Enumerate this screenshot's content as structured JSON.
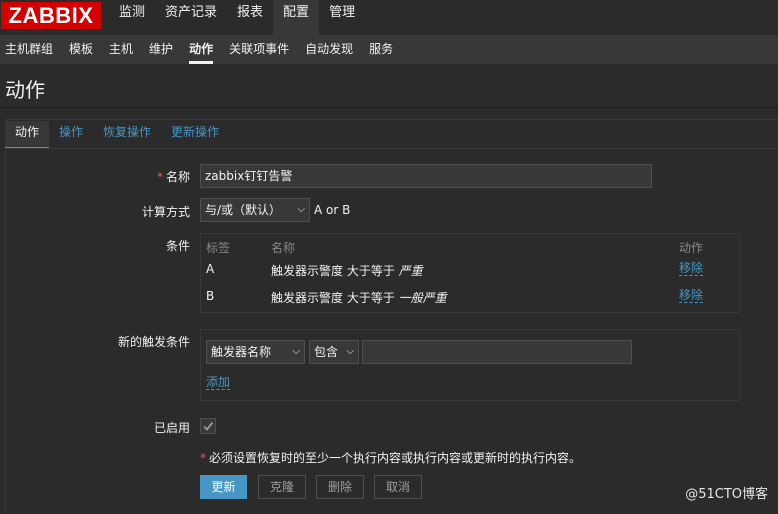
{
  "brand": "ZABBIX",
  "main_menu": [
    "监测",
    "资产记录",
    "报表",
    "配置",
    "管理"
  ],
  "sub_menu": [
    "主机群组",
    "模板",
    "主机",
    "维护",
    "动作",
    "关联项事件",
    "自动发现",
    "服务"
  ],
  "page_title": "动作",
  "tabs": [
    "动作",
    "操作",
    "恢复操作",
    "更新操作"
  ],
  "form": {
    "name_label": "名称",
    "name_value": "zabbix钉钉告警",
    "calc_label": "计算方式",
    "calc_value": "与/或（默认）",
    "calc_formula": "A or B",
    "conditions_label": "条件",
    "conditions_headers": {
      "tag": "标签",
      "name": "名称",
      "action": "动作"
    },
    "conditions": [
      {
        "tag": "A",
        "name_prefix": "触发器示警度 大于等于",
        "name_value": "严重",
        "action": "移除"
      },
      {
        "tag": "B",
        "name_prefix": "触发器示警度 大于等于",
        "name_value": "一般严重",
        "action": "移除"
      }
    ],
    "new_condition_label": "新的触发条件",
    "new_condition_type": "触发器名称",
    "new_condition_operator": "包含",
    "new_condition_value": "",
    "add_link": "添加",
    "enabled_label": "已启用",
    "enabled_checked": true,
    "note": "必须设置恢复时的至少一个执行内容或执行内容或更新时的执行内容。"
  },
  "buttons": {
    "update": "更新",
    "clone": "克隆",
    "delete": "删除",
    "cancel": "取消"
  },
  "watermark": "@51CTO博客",
  "colors": {
    "brand_red": "#d40000",
    "accent_blue": "#4796c4",
    "required_red": "#e45959"
  }
}
